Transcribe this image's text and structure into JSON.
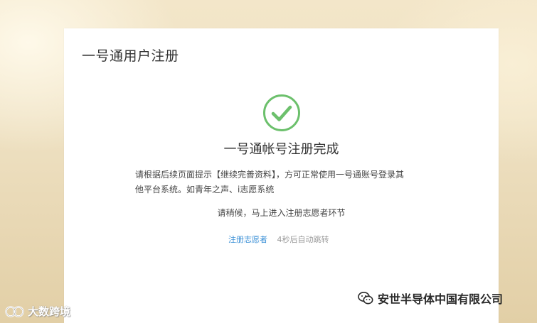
{
  "panel": {
    "title": "一号通用户注册"
  },
  "status": {
    "icon": "check-circle-icon",
    "color": "#6cc06c",
    "title": "一号通帐号注册完成",
    "desc_line1": "请根据后续页面提示【继续完善资料】，方可正常使用一号通账号登录其",
    "desc_line2": "他平台系统。如青年之声、i志愿系统",
    "wait_text": "请稍候，马上进入注册志愿者环节"
  },
  "actions": {
    "link_label": "注册志愿者",
    "countdown_text": "4秒后自动跳转",
    "link_color": "#3a8fd6"
  },
  "watermarks": {
    "right_text": "安世半导体中国有限公司",
    "left_text": "大数跨境"
  }
}
